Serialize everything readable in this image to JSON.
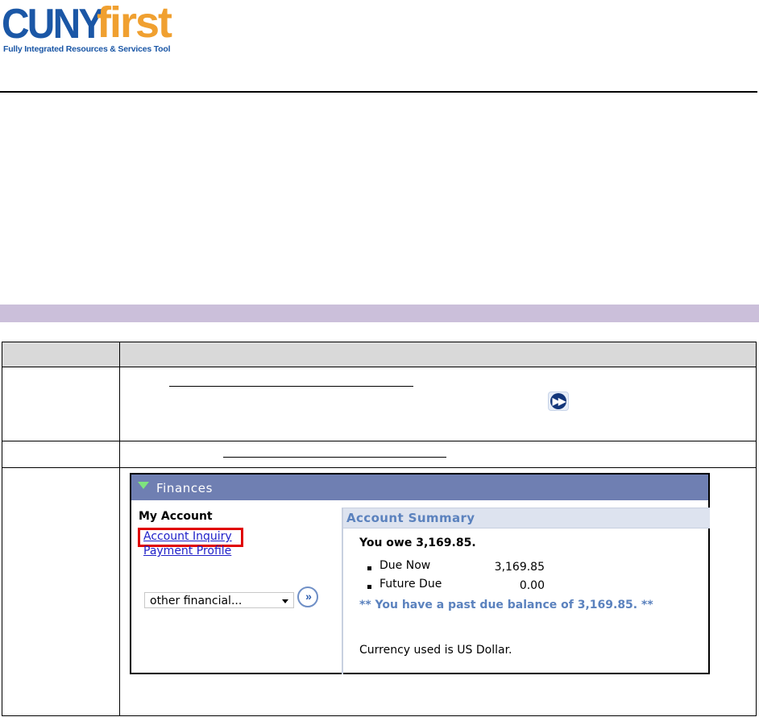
{
  "logo": {
    "brand_cuny": "CUNY",
    "brand_first": "first",
    "tagline": "Fully Integrated Resources & Services Tool"
  },
  "colors": {
    "brand_blue": "#1b57a6",
    "brand_orange": "#f0a030",
    "section_band": "#cbbfda",
    "finances_header": "#6f7fb2",
    "summary_text": "#5b82be",
    "highlight_box": "#e00000"
  },
  "finances": {
    "title": "Finances",
    "my_account_heading": "My Account",
    "links": [
      "Account Inquiry",
      "Payment Profile"
    ],
    "highlighted_link": "Account Inquiry",
    "dropdown_value": "other financial...",
    "account_summary": {
      "heading": "Account Summary",
      "you_owe": "You owe 3,169.85.",
      "rows": [
        {
          "label": "Due Now",
          "amount": "3,169.85"
        },
        {
          "label": "Future Due",
          "amount": "0.00"
        }
      ],
      "past_due_notice": "** You have a past due balance of 3,169.85. **",
      "currency_note": "Currency used is US Dollar."
    }
  },
  "icons": {
    "row1_go": "fast-forward-icon",
    "dropdown_go": "double-chevron-right-icon",
    "section_toggle": "triangle-down-icon"
  }
}
